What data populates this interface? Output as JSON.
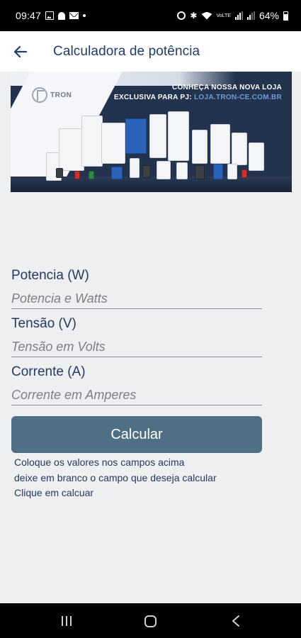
{
  "status_bar": {
    "time": "09:47",
    "battery_percent": "64%",
    "volte_label": "VoLTE"
  },
  "app_bar": {
    "title": "Calculadora de potência"
  },
  "banner": {
    "logo_text": "TRON",
    "headline_line1": "CONHEÇA NOSSA NOVA LOJA",
    "headline_line2_prefix": "EXCLUSIVA PARA PJ:",
    "headline_url": "LOJA.TRON-CE.COM.BR"
  },
  "form": {
    "fields": [
      {
        "label": "Potencia (W)",
        "placeholder": "Potencia e Watts",
        "value": ""
      },
      {
        "label": "Tensão (V)",
        "placeholder": "Tensão em Volts",
        "value": ""
      },
      {
        "label": "Corrente (A)",
        "placeholder": "Corrente em Amperes",
        "value": ""
      }
    ],
    "button_label": "Calcular"
  },
  "help": {
    "lines": [
      "Coloque os valores nos campos acima",
      "deixe em branco o campo que deseja calcular",
      "Clique em calcuar"
    ]
  },
  "colors": {
    "title": "#1f3d6b",
    "button": "#4f6f84",
    "background": "#eeeff1"
  }
}
